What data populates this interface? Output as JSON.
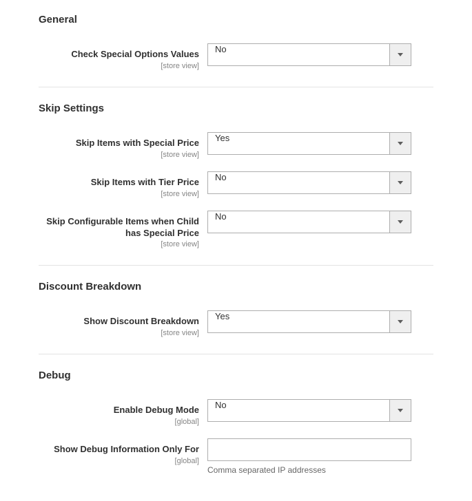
{
  "sections": {
    "general": {
      "title": "General",
      "check_special_options": {
        "label": "Check Special Options Values",
        "scope": "[store view]",
        "value": "No"
      }
    },
    "skip": {
      "title": "Skip Settings",
      "skip_special_price": {
        "label": "Skip Items with Special Price",
        "scope": "[store view]",
        "value": "Yes"
      },
      "skip_tier_price": {
        "label": "Skip Items with Tier Price",
        "scope": "[store view]",
        "value": "No"
      },
      "skip_config_child": {
        "label": "Skip Configurable Items when Child has Special Price",
        "scope": "[store view]",
        "value": "No"
      }
    },
    "discount": {
      "title": "Discount Breakdown",
      "show_breakdown": {
        "label": "Show Discount Breakdown",
        "scope": "[store view]",
        "value": "Yes"
      }
    },
    "debug": {
      "title": "Debug",
      "enable_debug": {
        "label": "Enable Debug Mode",
        "scope": "[global]",
        "value": "No"
      },
      "debug_ips": {
        "label": "Show Debug Information Only For",
        "scope": "[global]",
        "value": "",
        "help": "Comma separated IP addresses"
      }
    }
  }
}
